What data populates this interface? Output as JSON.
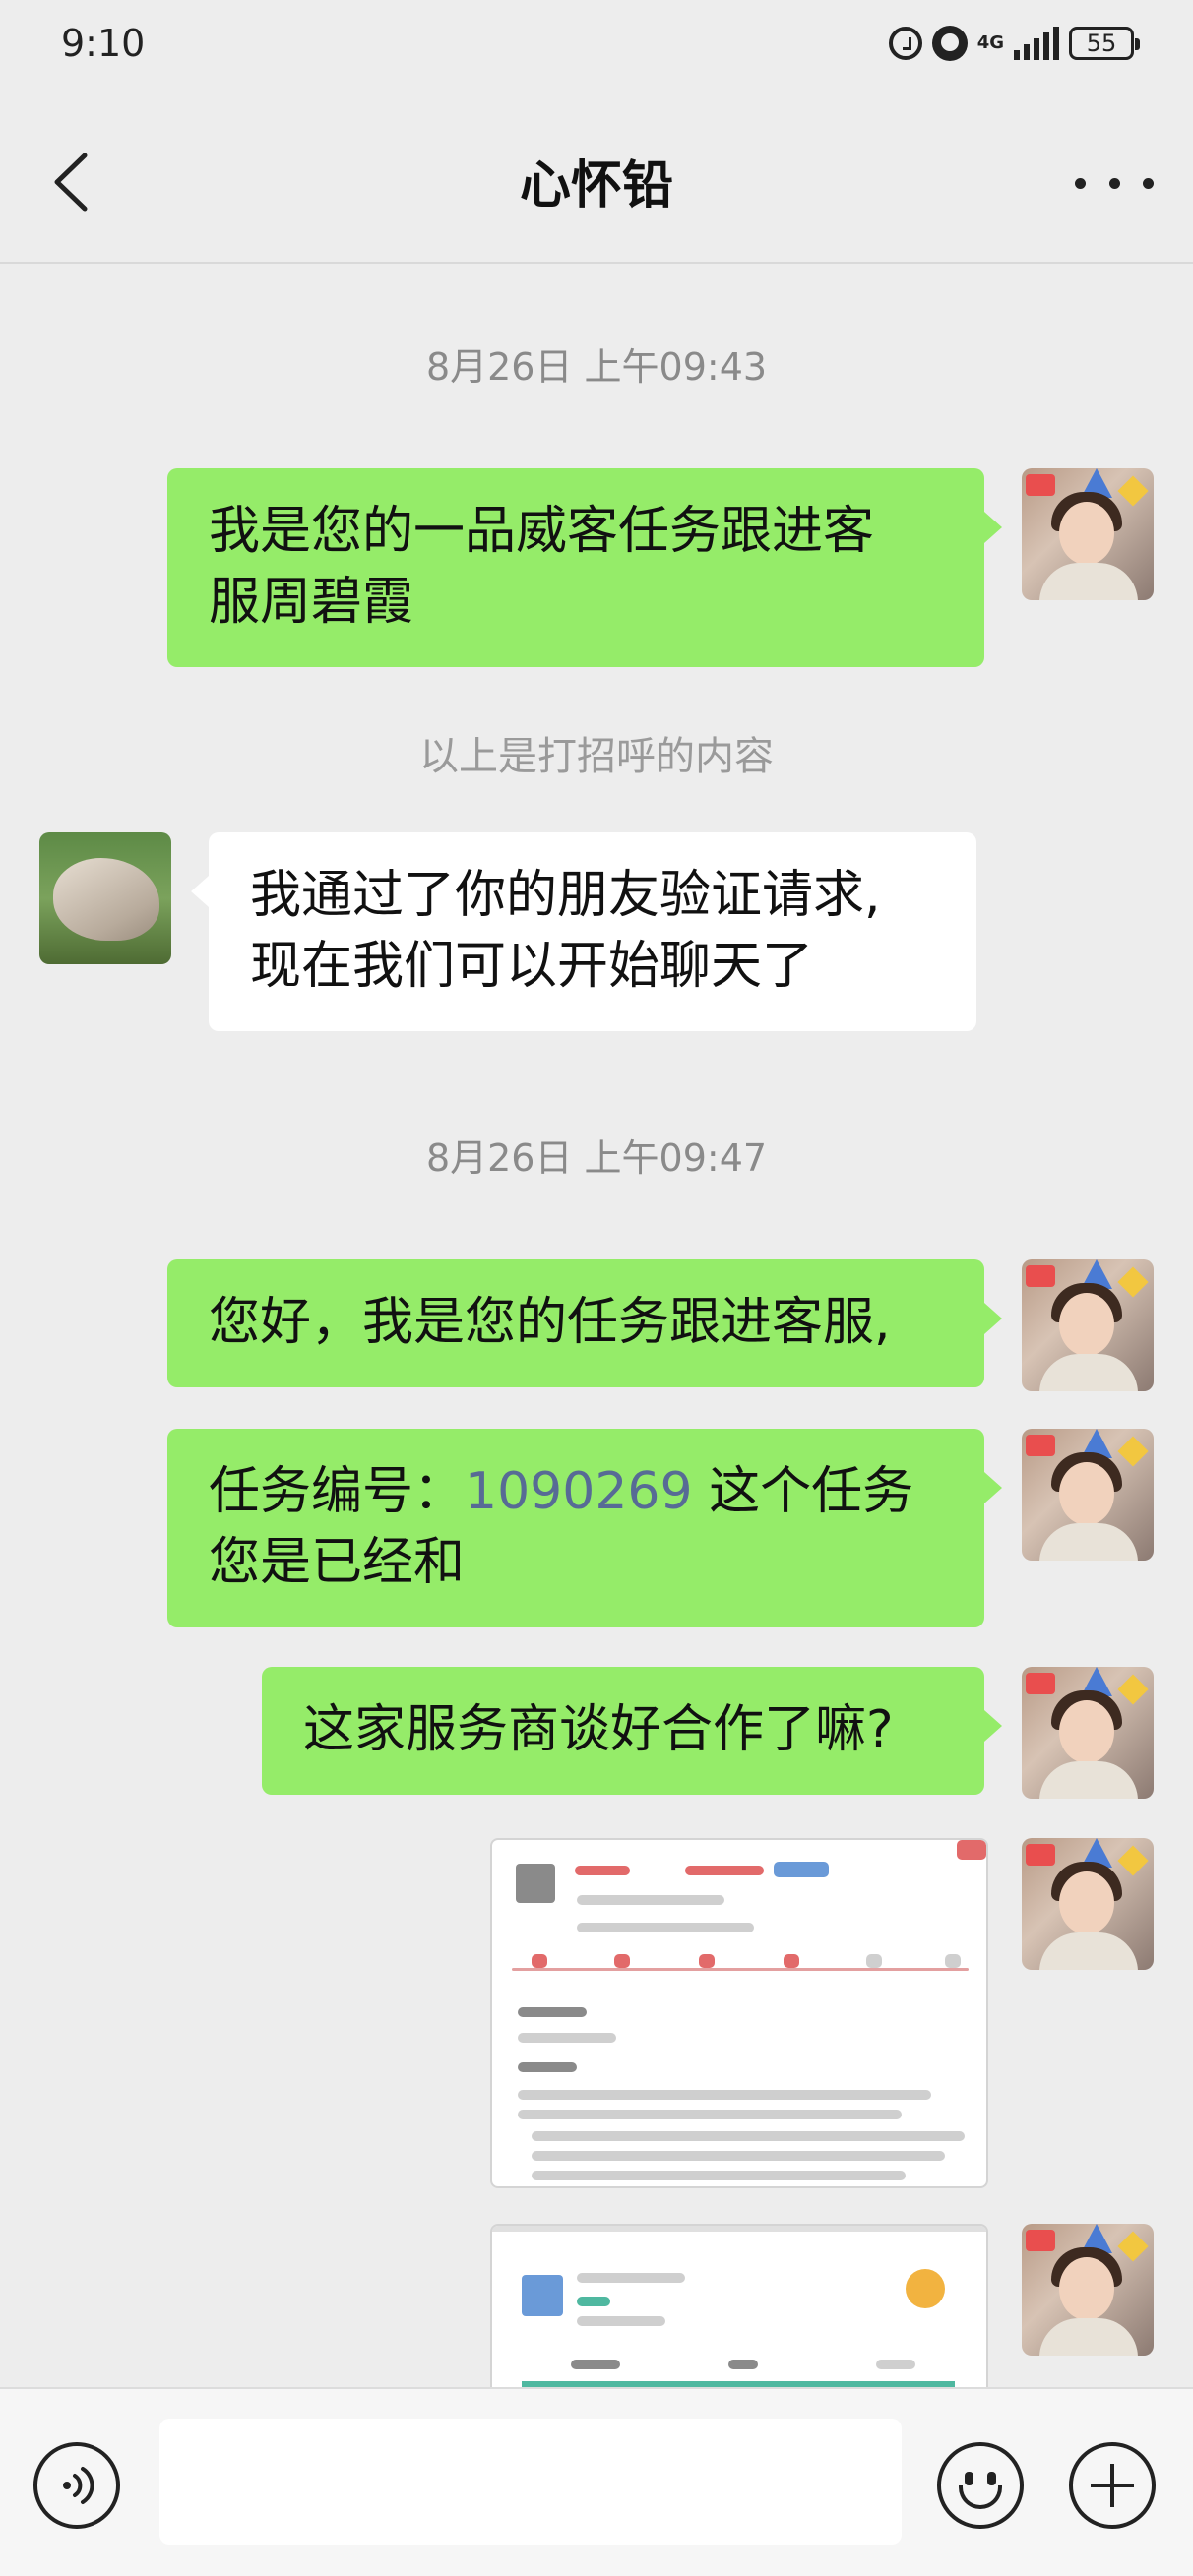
{
  "status_bar": {
    "time": "9:10",
    "network": "4G",
    "battery": "55",
    "icons": [
      "sync-icon",
      "alarm-icon",
      "signal-icon",
      "battery-icon"
    ]
  },
  "header": {
    "title": "心怀铅",
    "back_icon": "chevron-left-icon",
    "more_icon": "more-dots-icon"
  },
  "messages": [
    {
      "type": "timestamp",
      "text": "8月26日 上午09:43"
    },
    {
      "type": "text",
      "sender": "me",
      "lines": [
        "我是您的一品威客任务跟进客",
        "服周碧霞"
      ]
    },
    {
      "type": "system",
      "text": "以上是打招呼的内容"
    },
    {
      "type": "text",
      "sender": "other",
      "lines": [
        "我通过了你的朋友验证请求,",
        "现在我们可以开始聊天了"
      ]
    },
    {
      "type": "timestamp",
      "text": "8月26日 上午09:47"
    },
    {
      "type": "text",
      "sender": "me",
      "lines": [
        "您好，我是您的任务跟进客服,"
      ]
    },
    {
      "type": "text",
      "sender": "me",
      "prefix": "任务编号：",
      "link": "1090269",
      "suffix": " 这个任务",
      "line2": "您是已经和"
    },
    {
      "type": "text",
      "sender": "me",
      "lines": [
        "这家服务商谈好合作了嘛?"
      ]
    },
    {
      "type": "image",
      "sender": "me",
      "description": "task-screenshot"
    },
    {
      "type": "image",
      "sender": "me",
      "description": "service-provider-screenshot"
    }
  ],
  "input_bar": {
    "placeholder": "",
    "voice_icon": "voice-icon",
    "emoji_icon": "emoji-icon",
    "plus_icon": "plus-icon"
  },
  "colors": {
    "background": "#ededed",
    "my_bubble": "#95ec69",
    "their_bubble": "#ffffff",
    "link": "#576b95"
  }
}
